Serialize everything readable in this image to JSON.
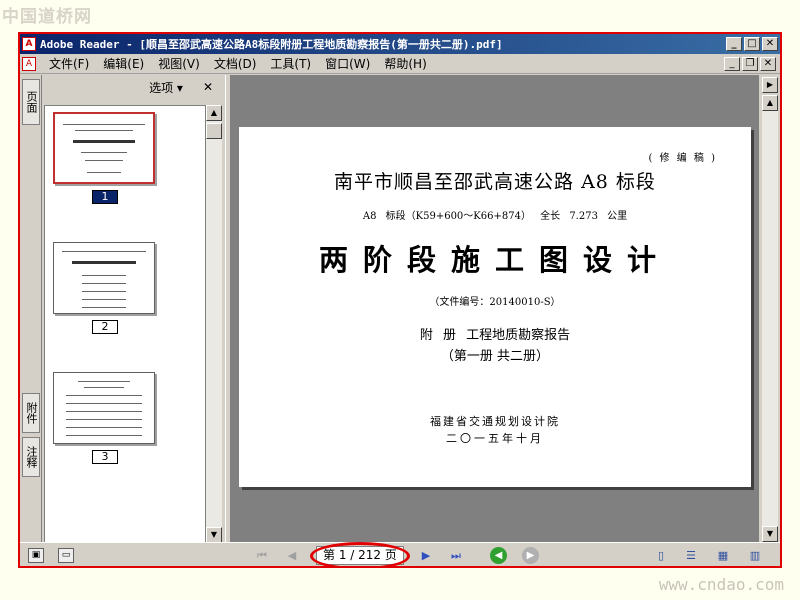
{
  "watermark": {
    "top": "中国道桥网",
    "bottom": "www.cndao.com"
  },
  "window": {
    "title": "Adobe Reader - [顺昌至邵武高速公路A8标段附册工程地质勘察报告(第一册共二册).pdf]",
    "app_icon_glyph": "A"
  },
  "menubar": {
    "items": [
      "文件(F)",
      "编辑(E)",
      "视图(V)",
      "文档(D)",
      "工具(T)",
      "窗口(W)",
      "帮助(H)"
    ]
  },
  "side_tabs": [
    "页面",
    "附件",
    "注释"
  ],
  "panel": {
    "options_label": "选项 ▾",
    "close_label": "✕",
    "thumbnail_labels": [
      "1",
      "2",
      "3"
    ],
    "selected_thumbnail": 1
  },
  "document": {
    "edition": "( 修 编 稿 )",
    "title": "南平市顺昌至邵武高速公路 A8 标段",
    "section": "A8 标段（K59+600～K66+874）   全长 7.273 公里",
    "design_title": "两阶段施工图设计",
    "file_no": "（文件编号：20140010-S）",
    "annex": "附    册      工程地质勘察报告",
    "volume": "（第一册 共二册）",
    "organization": "福建省交通规划设计院",
    "date": "二〇一五年十月"
  },
  "statusbar": {
    "page_indicator": "第 1 / 212 页",
    "first_page_glyph": "⏮",
    "prev_page_glyph": "◀",
    "next_page_glyph": "▶",
    "last_page_glyph": "⏭",
    "back_glyph": "◀",
    "forward_glyph": "▶",
    "highlight_color": "#e00000"
  },
  "colors": {
    "title_bar": "#0a246a",
    "frame_border": "#e00000",
    "viewer_bg": "#808080"
  }
}
